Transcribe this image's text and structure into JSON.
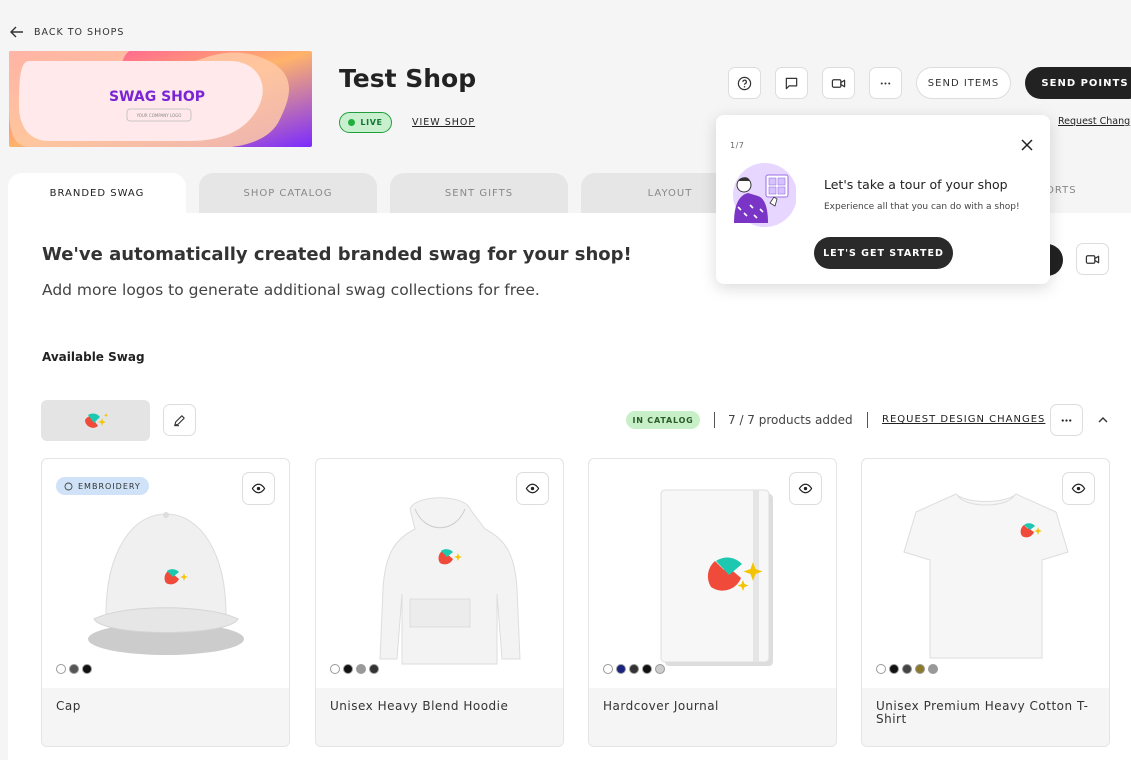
{
  "nav": {
    "back_label": "BACK TO SHOPS"
  },
  "banner": {
    "title": "SWAG SHOP",
    "subtitle": "YOUR COMPANY LOGO"
  },
  "shop": {
    "title": "Test Shop",
    "status": "LIVE",
    "view_label": "VIEW SHOP"
  },
  "header_actions": {
    "help_icon": "question-circle-icon",
    "chat_icon": "chat-bubble-icon",
    "video_icon": "video-camera-icon",
    "more_icon": "ellipsis-icon",
    "send_items_label": "SEND ITEMS",
    "send_points_label": "SEND POINTS",
    "request_change_label": "Request Chang"
  },
  "tabs": [
    {
      "label": "BRANDED SWAG",
      "active": true
    },
    {
      "label": "SHOP CATALOG",
      "active": false
    },
    {
      "label": "SENT GIFTS",
      "active": false
    },
    {
      "label": "LAYOUT",
      "active": false
    },
    {
      "label": "ORTS",
      "active": false
    }
  ],
  "main": {
    "headline": "We've automatically created branded swag for your shop!",
    "subline": "Add more logos to generate additional swag collections for free.",
    "available_label": "Available Swag"
  },
  "collection": {
    "status_badge": "IN CATALOG",
    "products_added": "7 / 7 products added",
    "request_design_label": "REQUEST DESIGN CHANGES"
  },
  "products": [
    {
      "name": "Cap",
      "badge": "EMBROIDERY",
      "swatches": [
        "#ffffff",
        "#555555",
        "#111111"
      ]
    },
    {
      "name": "Unisex Heavy Blend Hoodie",
      "swatches": [
        "#ffffff",
        "#111111",
        "#999999",
        "#333333"
      ]
    },
    {
      "name": "Hardcover Journal",
      "swatches": [
        "#ffffff",
        "#1a237e",
        "#333333",
        "#111111",
        "#cccccc"
      ]
    },
    {
      "name": "Unisex Premium Heavy Cotton T-Shirt",
      "swatches": [
        "#ffffff",
        "#111111",
        "#444444",
        "#8a7a2a",
        "#999999"
      ]
    }
  ],
  "tour": {
    "step": "1/7",
    "title": "Let's take a tour of your shop",
    "subtitle": "Experience all that you can do with a shop!",
    "cta_label": "LET'S GET STARTED"
  },
  "colors": {
    "primary_dark": "#222222",
    "live_green": "#1fb03c",
    "catalog_green": "#c8f0c8",
    "embroidery_blue": "#cfe2f7"
  }
}
